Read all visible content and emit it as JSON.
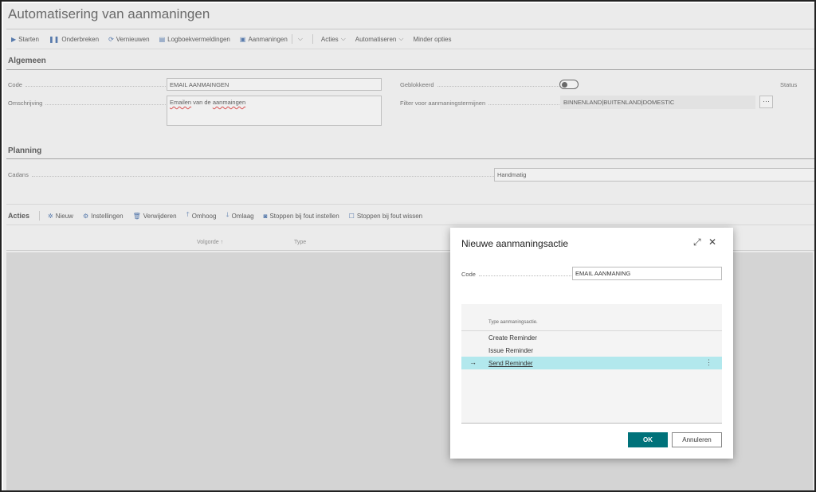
{
  "page": {
    "title": "Automatisering van aanmaningen"
  },
  "toolbar": {
    "starten": "Starten",
    "onderbreken": "Onderbreken",
    "vernieuwen": "Vernieuwen",
    "logboek": "Logboekvermeldingen",
    "aanmaningen": "Aanmaningen",
    "acties": "Acties",
    "automatiseren": "Automatiseren",
    "minder": "Minder opties"
  },
  "general": {
    "section_title": "Algemeen",
    "code_label": "Code",
    "code_value": "EMAIL AANMAINGEN",
    "omschrijving_label": "Omschrijving",
    "omschrijving_value_1": "Emailen",
    "omschrijving_value_2": "van de",
    "omschrijving_value_3": "aanmaingen",
    "geblokkeerd_label": "Geblokkeerd",
    "geblokkeerd_value": false,
    "filter_label": "Filter voor aanmaningstermijnen",
    "filter_value": "BINNENLAND|BUITENLAND|DOMESTIC",
    "status_label": "Status"
  },
  "planning": {
    "section_title": "Planning",
    "cadans_label": "Cadans",
    "cadans_value": "Handmatig"
  },
  "actions_bar": {
    "title": "Acties",
    "nieuw": "Nieuw",
    "instellingen": "Instellingen",
    "verwijderen": "Verwijderen",
    "omhoog": "Omhoog",
    "omlaag": "Omlaag",
    "stoppen_instellen": "Stoppen bij fout instellen",
    "stoppen_wissen": "Stoppen bij fout wissen"
  },
  "grid": {
    "col_volgorde": "Volgorde ↑",
    "col_type": "Type"
  },
  "dialog": {
    "title": "Nieuwe aanmaningsactie",
    "code_label": "Code",
    "code_value": "EMAIL AANMANING",
    "list_header": "Type aanmaningsactie.",
    "options": [
      "Create Reminder",
      "Issue Reminder",
      "Send Reminder"
    ],
    "selected_index": 2,
    "ok_label": "OK",
    "cancel_label": "Annuleren"
  },
  "colors": {
    "accent": "#00727a",
    "selection": "#b2e8ed",
    "icon": "#2a5aa0"
  }
}
